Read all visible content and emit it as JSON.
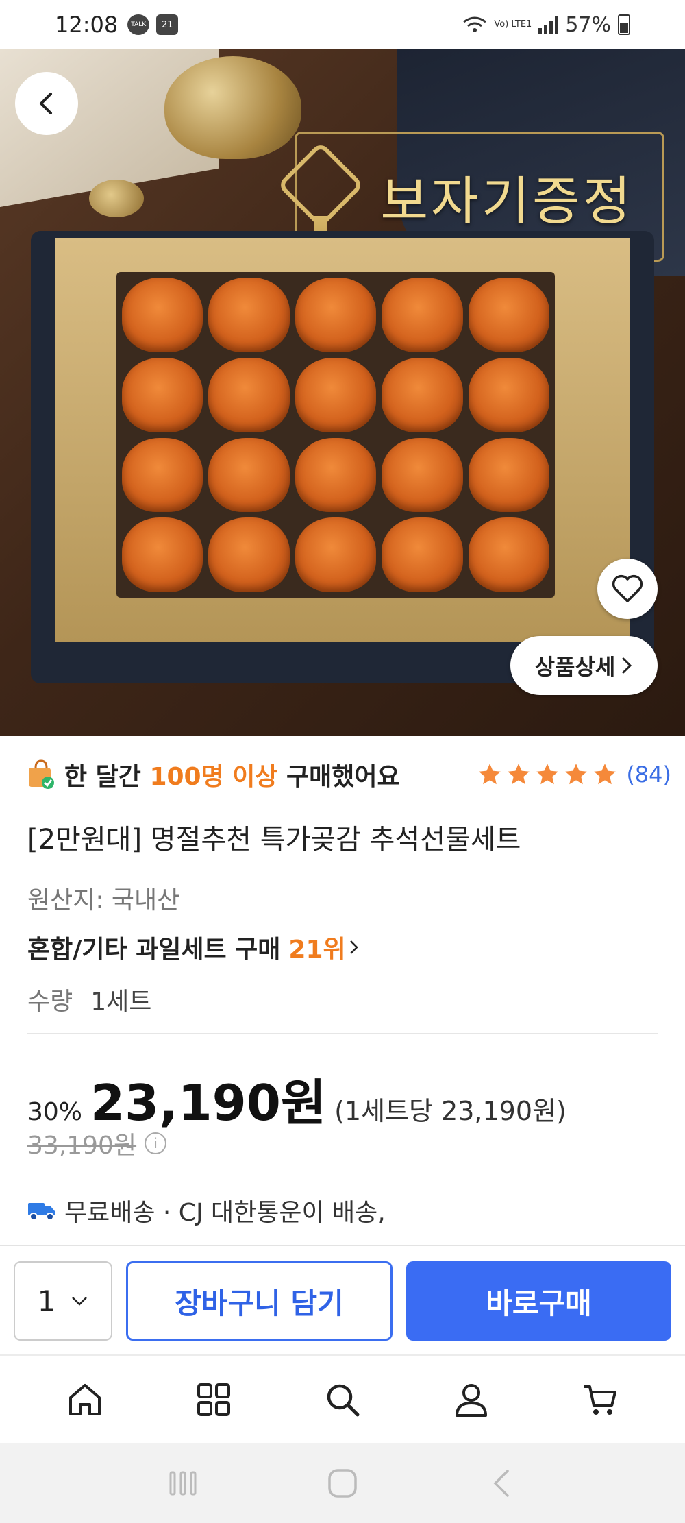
{
  "status_bar": {
    "time": "12:08",
    "badges": [
      "TALK",
      "21"
    ],
    "battery": "57%",
    "network": "Vo) LTE1"
  },
  "hero": {
    "banner_text": "보자기증정",
    "detail_button": "상품상세"
  },
  "social_proof": {
    "prefix": "한 달간",
    "highlight": "100명 이상",
    "suffix": "구매했어요"
  },
  "rating": {
    "stars": 5,
    "review_count": "(84)"
  },
  "product": {
    "title": "[2만원대] 명절추천 특가곶감 추석선물세트",
    "origin": "원산지: 국내산",
    "rank_label": "혼합/기타 과일세트 구매",
    "rank_value": "21위",
    "qty_label": "수량",
    "qty_value": "1세트"
  },
  "price": {
    "discount": "30%",
    "sale_price": "23,190원",
    "unit_price": "(1세트당 23,190원)",
    "original_price": "33,190원"
  },
  "shipping": {
    "text": "무료배송 · CJ 대한통운이 배송,"
  },
  "actions": {
    "quantity": "1",
    "cart_label": "장바구니 담기",
    "buy_label": "바로구매"
  },
  "tabs": [
    "home-icon",
    "grid-icon",
    "search-icon",
    "user-icon",
    "cart-icon"
  ],
  "colors": {
    "accent_blue": "#3a6cf3",
    "highlight_orange": "#f07c1e",
    "star_orange": "#f5893a",
    "review_blue": "#3b6ee5"
  }
}
